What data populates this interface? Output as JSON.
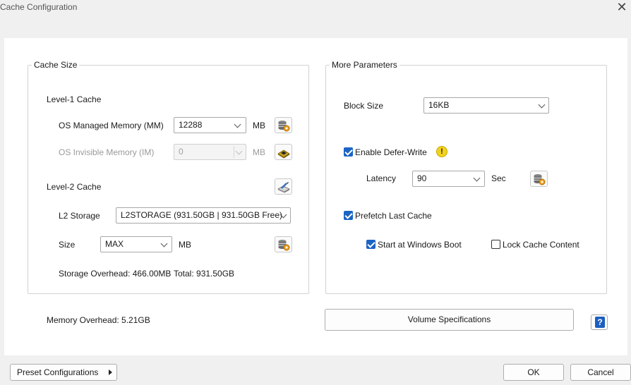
{
  "window": {
    "title": "Cache Configuration",
    "close_glyph": "✕"
  },
  "cache_size": {
    "legend": "Cache Size",
    "level1": {
      "heading": "Level-1 Cache",
      "os_managed": {
        "label": "OS Managed Memory (MM)",
        "value": "12288",
        "unit": "MB"
      },
      "os_invisible": {
        "label": "OS Invisible Memory (IM)",
        "value": "0",
        "unit": "MB"
      }
    },
    "level2": {
      "heading": "Level-2 Cache",
      "storage": {
        "label": "L2 Storage",
        "value": "L2STORAGE (931.50GB | 931.50GB Free)"
      },
      "size": {
        "label": "Size",
        "value": "MAX",
        "unit": "MB"
      },
      "overhead": "Storage Overhead: 466.00MB",
      "total": "Total: 931.50GB"
    }
  },
  "more_parameters": {
    "legend": "More Parameters",
    "block_size": {
      "label": "Block Size",
      "value": "16KB"
    },
    "defer_write": {
      "label": "Enable Defer-Write",
      "checked": true,
      "warning_glyph": "!"
    },
    "latency": {
      "label": "Latency",
      "value": "90",
      "unit": "Sec"
    },
    "prefetch": {
      "label": "Prefetch Last Cache",
      "checked": true
    },
    "start_at_boot": {
      "label": "Start at Windows Boot",
      "checked": true
    },
    "lock_cache": {
      "label": "Lock Cache Content",
      "checked": false
    }
  },
  "memory_overhead": "Memory Overhead: 5.21GB",
  "buttons": {
    "volume_specs": "Volume Specifications",
    "help": "?",
    "preset": "Preset Configurations",
    "ok": "OK",
    "cancel": "Cancel"
  },
  "colors": {
    "accent": "#1c64c4",
    "warning": "#f2d21c",
    "panel_bg": "#ffffff",
    "chrome_bg": "#f0f0f0"
  },
  "icons": {
    "mm_button": "database-gear-icon",
    "im_button": "chip-icon",
    "l2_button": "drive-edit-icon",
    "size_button": "database-gear-icon",
    "latency_button": "database-gear-icon"
  }
}
